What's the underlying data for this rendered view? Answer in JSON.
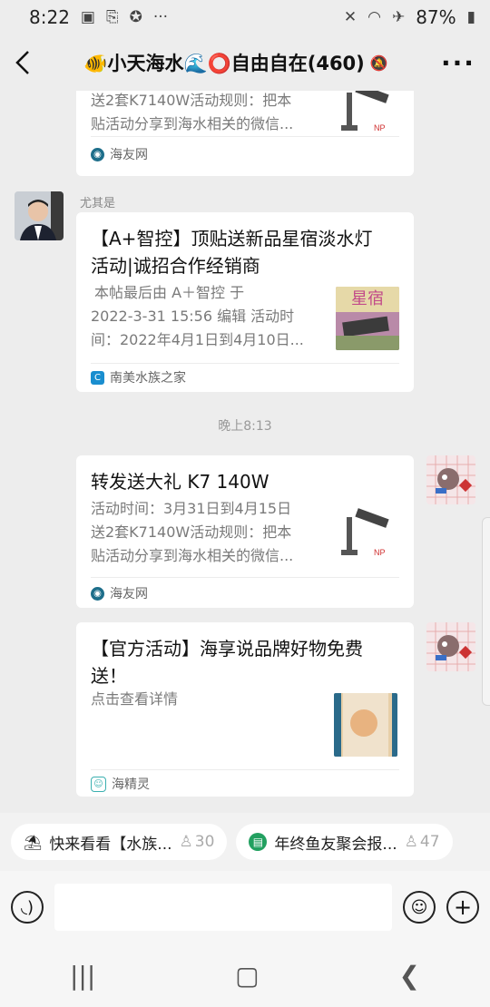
{
  "status": {
    "time": "8:22",
    "battery": "87%"
  },
  "header": {
    "title": "🐠小天海水🌊⭕自由自在(460)",
    "mute_icon": "bell-off-icon"
  },
  "messages": {
    "card0": {
      "desc_line1": "送2套K7140W活动规则：把本",
      "desc_line2": "贴活动分享到海水相关的微信...",
      "source": "海友网"
    },
    "sender1": "尤其是",
    "card1": {
      "title_line1": "【A+智控】顶贴送新品星宿淡水灯",
      "title_line2": "活动|诚招合作经销商",
      "desc_line1": "本帖最后由 A＋智控 于",
      "desc_line2": "2022-3-31 15:56 编辑 活动时",
      "desc_line3": "间：2022年4月1日到4月10日...",
      "thumb_text": "星宿",
      "source": "南美水族之家"
    },
    "timestamp": "晚上8:13",
    "card2": {
      "title": "转发送大礼 K7 140W",
      "desc_line1": "活动时间：3月31日到4月15日",
      "desc_line2": "送2套K7140W活动规则：把本",
      "desc_line3": "贴活动分享到海水相关的微信...",
      "source": "海友网"
    },
    "card3": {
      "title_line1": "【官方活动】海享说品牌好物免费",
      "title_line2": "送！",
      "desc": "点击查看详情",
      "source": "海精灵"
    }
  },
  "pins": [
    {
      "label": "快来看看【水族...",
      "count": "30"
    },
    {
      "label": "年终鱼友聚会报...",
      "count": "47"
    }
  ],
  "colors": {
    "background": "#ededed",
    "card": "#ffffff"
  }
}
